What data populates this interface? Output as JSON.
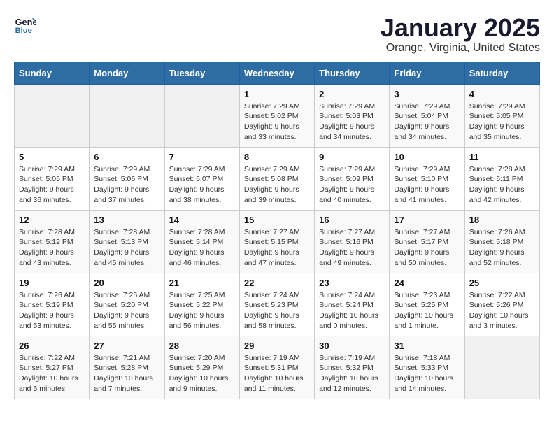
{
  "logo": {
    "line1": "General",
    "line2": "Blue"
  },
  "title": "January 2025",
  "subtitle": "Orange, Virginia, United States",
  "days_of_week": [
    "Sunday",
    "Monday",
    "Tuesday",
    "Wednesday",
    "Thursday",
    "Friday",
    "Saturday"
  ],
  "weeks": [
    [
      {
        "day": "",
        "info": ""
      },
      {
        "day": "",
        "info": ""
      },
      {
        "day": "",
        "info": ""
      },
      {
        "day": "1",
        "info": "Sunrise: 7:29 AM\nSunset: 5:02 PM\nDaylight: 9 hours\nand 33 minutes."
      },
      {
        "day": "2",
        "info": "Sunrise: 7:29 AM\nSunset: 5:03 PM\nDaylight: 9 hours\nand 34 minutes."
      },
      {
        "day": "3",
        "info": "Sunrise: 7:29 AM\nSunset: 5:04 PM\nDaylight: 9 hours\nand 34 minutes."
      },
      {
        "day": "4",
        "info": "Sunrise: 7:29 AM\nSunset: 5:05 PM\nDaylight: 9 hours\nand 35 minutes."
      }
    ],
    [
      {
        "day": "5",
        "info": "Sunrise: 7:29 AM\nSunset: 5:05 PM\nDaylight: 9 hours\nand 36 minutes."
      },
      {
        "day": "6",
        "info": "Sunrise: 7:29 AM\nSunset: 5:06 PM\nDaylight: 9 hours\nand 37 minutes."
      },
      {
        "day": "7",
        "info": "Sunrise: 7:29 AM\nSunset: 5:07 PM\nDaylight: 9 hours\nand 38 minutes."
      },
      {
        "day": "8",
        "info": "Sunrise: 7:29 AM\nSunset: 5:08 PM\nDaylight: 9 hours\nand 39 minutes."
      },
      {
        "day": "9",
        "info": "Sunrise: 7:29 AM\nSunset: 5:09 PM\nDaylight: 9 hours\nand 40 minutes."
      },
      {
        "day": "10",
        "info": "Sunrise: 7:29 AM\nSunset: 5:10 PM\nDaylight: 9 hours\nand 41 minutes."
      },
      {
        "day": "11",
        "info": "Sunrise: 7:28 AM\nSunset: 5:11 PM\nDaylight: 9 hours\nand 42 minutes."
      }
    ],
    [
      {
        "day": "12",
        "info": "Sunrise: 7:28 AM\nSunset: 5:12 PM\nDaylight: 9 hours\nand 43 minutes."
      },
      {
        "day": "13",
        "info": "Sunrise: 7:28 AM\nSunset: 5:13 PM\nDaylight: 9 hours\nand 45 minutes."
      },
      {
        "day": "14",
        "info": "Sunrise: 7:28 AM\nSunset: 5:14 PM\nDaylight: 9 hours\nand 46 minutes."
      },
      {
        "day": "15",
        "info": "Sunrise: 7:27 AM\nSunset: 5:15 PM\nDaylight: 9 hours\nand 47 minutes."
      },
      {
        "day": "16",
        "info": "Sunrise: 7:27 AM\nSunset: 5:16 PM\nDaylight: 9 hours\nand 49 minutes."
      },
      {
        "day": "17",
        "info": "Sunrise: 7:27 AM\nSunset: 5:17 PM\nDaylight: 9 hours\nand 50 minutes."
      },
      {
        "day": "18",
        "info": "Sunrise: 7:26 AM\nSunset: 5:18 PM\nDaylight: 9 hours\nand 52 minutes."
      }
    ],
    [
      {
        "day": "19",
        "info": "Sunrise: 7:26 AM\nSunset: 5:19 PM\nDaylight: 9 hours\nand 53 minutes."
      },
      {
        "day": "20",
        "info": "Sunrise: 7:25 AM\nSunset: 5:20 PM\nDaylight: 9 hours\nand 55 minutes."
      },
      {
        "day": "21",
        "info": "Sunrise: 7:25 AM\nSunset: 5:22 PM\nDaylight: 9 hours\nand 56 minutes."
      },
      {
        "day": "22",
        "info": "Sunrise: 7:24 AM\nSunset: 5:23 PM\nDaylight: 9 hours\nand 58 minutes."
      },
      {
        "day": "23",
        "info": "Sunrise: 7:24 AM\nSunset: 5:24 PM\nDaylight: 10 hours\nand 0 minutes."
      },
      {
        "day": "24",
        "info": "Sunrise: 7:23 AM\nSunset: 5:25 PM\nDaylight: 10 hours\nand 1 minute."
      },
      {
        "day": "25",
        "info": "Sunrise: 7:22 AM\nSunset: 5:26 PM\nDaylight: 10 hours\nand 3 minutes."
      }
    ],
    [
      {
        "day": "26",
        "info": "Sunrise: 7:22 AM\nSunset: 5:27 PM\nDaylight: 10 hours\nand 5 minutes."
      },
      {
        "day": "27",
        "info": "Sunrise: 7:21 AM\nSunset: 5:28 PM\nDaylight: 10 hours\nand 7 minutes."
      },
      {
        "day": "28",
        "info": "Sunrise: 7:20 AM\nSunset: 5:29 PM\nDaylight: 10 hours\nand 9 minutes."
      },
      {
        "day": "29",
        "info": "Sunrise: 7:19 AM\nSunset: 5:31 PM\nDaylight: 10 hours\nand 11 minutes."
      },
      {
        "day": "30",
        "info": "Sunrise: 7:19 AM\nSunset: 5:32 PM\nDaylight: 10 hours\nand 12 minutes."
      },
      {
        "day": "31",
        "info": "Sunrise: 7:18 AM\nSunset: 5:33 PM\nDaylight: 10 hours\nand 14 minutes."
      },
      {
        "day": "",
        "info": ""
      }
    ]
  ]
}
